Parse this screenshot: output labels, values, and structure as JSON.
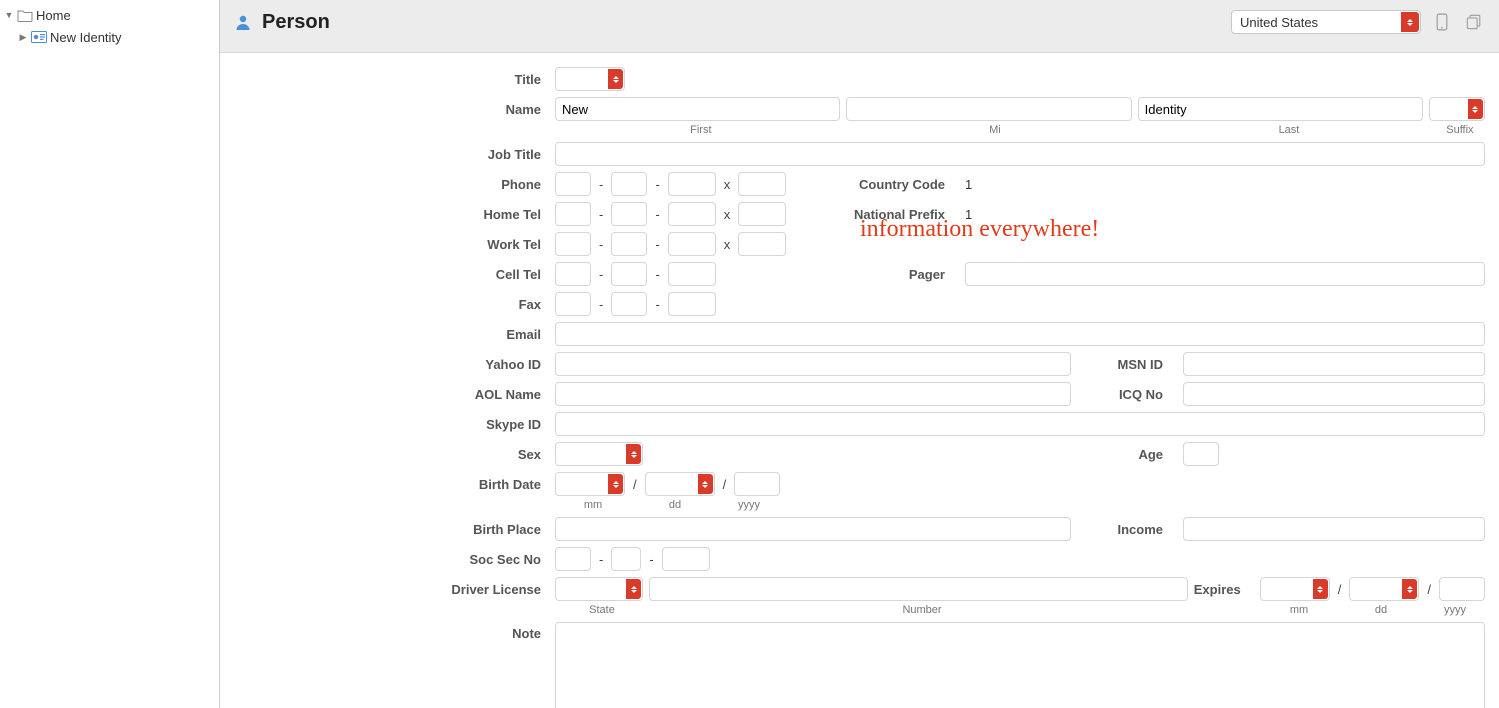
{
  "sidebar": {
    "home_label": "Home",
    "new_identity_label": "New Identity"
  },
  "header": {
    "title": "Person",
    "country_selected": "United States"
  },
  "labels": {
    "title": "Title",
    "name": "Name",
    "first": "First",
    "mi": "Mi",
    "last": "Last",
    "suffix": "Suffix",
    "job_title": "Job Title",
    "phone": "Phone",
    "home_tel": "Home Tel",
    "work_tel": "Work Tel",
    "cell_tel": "Cell Tel",
    "fax": "Fax",
    "country_code": "Country Code",
    "national_prefix": "National Prefix",
    "pager": "Pager",
    "email": "Email",
    "yahoo_id": "Yahoo ID",
    "msn_id": "MSN ID",
    "aol_name": "AOL Name",
    "icq_no": "ICQ No",
    "skype_id": "Skype ID",
    "sex": "Sex",
    "age": "Age",
    "birth_date": "Birth Date",
    "mm": "mm",
    "dd": "dd",
    "yyyy": "yyyy",
    "birth_place": "Birth Place",
    "income": "Income",
    "soc_sec_no": "Soc Sec No",
    "driver_license": "Driver License",
    "state": "State",
    "number": "Number",
    "expires": "Expires",
    "note": "Note"
  },
  "values": {
    "name_first": "New",
    "name_mi": "",
    "name_last": "Identity",
    "name_suffix": "",
    "country_code": "1",
    "national_prefix": "1"
  },
  "annotation": "information everywhere!"
}
